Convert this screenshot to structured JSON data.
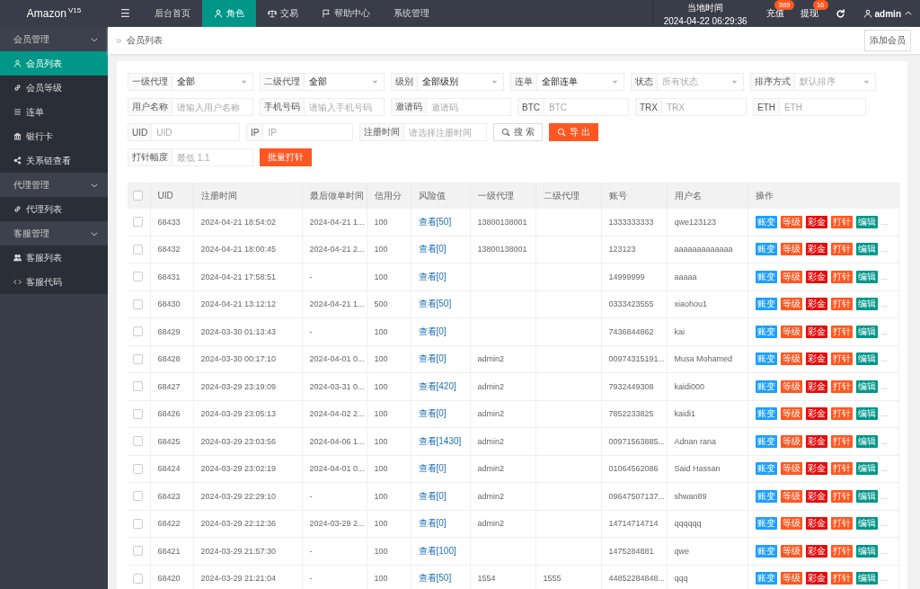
{
  "topbar": {
    "logo": "Amazon",
    "version": "V15",
    "menu_icon": "☰",
    "nav": [
      {
        "label": "后台首页",
        "selected": false
      },
      {
        "label": "角色",
        "selected": true
      },
      {
        "label": "交易",
        "selected": false
      },
      {
        "label": "帮助中心",
        "selected": false
      },
      {
        "label": "系统管理",
        "selected": false
      }
    ],
    "clock": {
      "label": "当地时间",
      "time": "2024-04-22 06:29:36"
    },
    "counters": [
      {
        "label": "充值",
        "badge": "389"
      },
      {
        "label": "提现",
        "badge": "16"
      }
    ],
    "user": "admin"
  },
  "sidebar": {
    "groups": [
      {
        "label": "会员管理",
        "expanded": true,
        "children": [
          {
            "label": "会员列表",
            "selected": true
          },
          {
            "label": "会员等级",
            "selected": false
          },
          {
            "label": "连单",
            "selected": false
          },
          {
            "label": "银行卡",
            "selected": false
          },
          {
            "label": "关系链查看",
            "selected": false
          }
        ]
      },
      {
        "label": "代理管理",
        "expanded": true,
        "children": [
          {
            "label": "代理列表",
            "selected": false
          }
        ]
      },
      {
        "label": "客服管理",
        "expanded": true,
        "children": [
          {
            "label": "客服列表",
            "selected": false
          },
          {
            "label": "客服代码",
            "selected": false
          }
        ]
      }
    ]
  },
  "breadcrumb": "会员列表",
  "add_button": "添加会员",
  "filters": [
    [
      {
        "kind": "select",
        "label": "一级代理",
        "value": "全部"
      },
      {
        "kind": "select",
        "label": "二级代理",
        "value": "全部"
      },
      {
        "kind": "select",
        "label": "级别",
        "value": "全部级别"
      },
      {
        "kind": "select",
        "label": "连单",
        "value": "全部连单"
      },
      {
        "kind": "select",
        "label": "状态",
        "placeholder": "所有状态"
      },
      {
        "kind": "select",
        "label": "排序方式",
        "placeholder": "默认排序"
      }
    ],
    [
      {
        "kind": "input",
        "label": "用户名称",
        "placeholder": "请输入用户名称"
      },
      {
        "kind": "input",
        "label": "手机号码",
        "placeholder": "请输入手机号码"
      },
      {
        "kind": "input",
        "label": "邀请码",
        "placeholder": "邀请码"
      },
      {
        "kind": "input",
        "label": "BTC",
        "placeholder": "BTC"
      },
      {
        "kind": "input",
        "label": "TRX",
        "placeholder": "TRX"
      },
      {
        "kind": "input",
        "label": "ETH",
        "placeholder": "ETH"
      }
    ],
    [
      {
        "kind": "input",
        "label": "UID",
        "placeholder": "UID"
      },
      {
        "kind": "input",
        "label": "IP",
        "placeholder": "IP"
      },
      {
        "kind": "input",
        "label": "注册时间",
        "placeholder": "请选择注册时间"
      },
      {
        "kind": "button",
        "label": "搜 索"
      },
      {
        "kind": "button",
        "label": "导 出"
      }
    ],
    [
      {
        "kind": "input",
        "label": "打针幅度",
        "placeholder": "最低 1.1"
      },
      {
        "kind": "button",
        "label": "批量打针"
      }
    ]
  ],
  "table": {
    "header_checkbox": {
      "checked": false
    },
    "columns": [
      "UID",
      "注册时间",
      "最后做单时间",
      "信用分",
      "风险值",
      "一级代理",
      "二级代理",
      "账号",
      "用户名",
      "操作"
    ],
    "rows": [
      {
        "checked": false,
        "uid": "68433",
        "registered": "2024-04-21 18:54:02",
        "last_order": "2024-04-21 1...",
        "credit": "100",
        "risk": "查看[50]",
        "agent_1": "13800138001",
        "account": "1333333333",
        "username": "qwe123123",
        "actions": [
          {
            "label": "账变",
            "color": "#1e9fff"
          },
          {
            "label": "等级",
            "color": "#ff5722"
          },
          {
            "label": "彩金",
            "color": "#e50e0e"
          },
          {
            "label": "打针",
            "color": "#ff5722"
          },
          {
            "label": "编辑",
            "color": "#009688"
          }
        ],
        "more": "..."
      },
      {
        "checked": false,
        "uid": "68432",
        "registered": "2024-04-21 18:00:45",
        "last_order": "2024-04-21 2...",
        "credit": "100",
        "risk": "查看[0]",
        "agent_1": "13800138001",
        "account": "123123",
        "username": "aaaaaaaaaaaaa",
        "actions": [
          {
            "label": "账变",
            "color": "#1e9fff"
          },
          {
            "label": "等级",
            "color": "#ff5722"
          },
          {
            "label": "彩金",
            "color": "#e50e0e"
          },
          {
            "label": "打针",
            "color": "#ff5722"
          },
          {
            "label": "编辑",
            "color": "#009688"
          }
        ],
        "more": "..."
      },
      {
        "checked": false,
        "uid": "68431",
        "registered": "2024-04-21 17:58:51",
        "last_order": "-",
        "credit": "100",
        "risk": "查看[0]",
        "account": "14999999",
        "username": "aaaaa",
        "actions": [
          {
            "label": "账变",
            "color": "#1e9fff"
          },
          {
            "label": "等级",
            "color": "#ff5722"
          },
          {
            "label": "彩金",
            "color": "#e50e0e"
          },
          {
            "label": "打针",
            "color": "#ff5722"
          },
          {
            "label": "编辑",
            "color": "#009688"
          }
        ],
        "more": "..."
      },
      {
        "checked": false,
        "uid": "68430",
        "registered": "2024-04-21 13:12:12",
        "last_order": "2024-04-21 1...",
        "credit": "500",
        "risk": "查看[50]",
        "account": "0333423555",
        "username": "xiaohou1",
        "actions": [
          {
            "label": "账变",
            "color": "#1e9fff"
          },
          {
            "label": "等级",
            "color": "#ff5722"
          },
          {
            "label": "彩金",
            "color": "#e50e0e"
          },
          {
            "label": "打针",
            "color": "#ff5722"
          },
          {
            "label": "编辑",
            "color": "#009688"
          }
        ],
        "more": "..."
      },
      {
        "checked": false,
        "uid": "68429",
        "registered": "2024-03-30 01:13:43",
        "last_order": "-",
        "credit": "100",
        "risk": "查看[0]",
        "account": "7436844862",
        "username": "kai",
        "actions": [
          {
            "label": "账变",
            "color": "#1e9fff"
          },
          {
            "label": "等级",
            "color": "#ff5722"
          },
          {
            "label": "彩金",
            "color": "#e50e0e"
          },
          {
            "label": "打针",
            "color": "#ff5722"
          },
          {
            "label": "编辑",
            "color": "#009688"
          }
        ],
        "more": "..."
      },
      {
        "checked": false,
        "uid": "68428",
        "registered": "2024-03-30 00:17:10",
        "last_order": "2024-04-01 0...",
        "credit": "100",
        "risk": "查看[0]",
        "agent_1": "admin2",
        "account": "00974315191...",
        "username": "Musa Mohamed",
        "actions": [
          {
            "label": "账变",
            "color": "#1e9fff"
          },
          {
            "label": "等级",
            "color": "#ff5722"
          },
          {
            "label": "彩金",
            "color": "#e50e0e"
          },
          {
            "label": "打针",
            "color": "#ff5722"
          },
          {
            "label": "编辑",
            "color": "#009688"
          }
        ],
        "more": "..."
      },
      {
        "checked": false,
        "uid": "68427",
        "registered": "2024-03-29 23:19:09",
        "last_order": "2024-03-31 0...",
        "credit": "100",
        "risk": "查看[420]",
        "agent_1": "admin2",
        "account": "7932449308",
        "username": "kaidi000",
        "actions": [
          {
            "label": "账变",
            "color": "#1e9fff"
          },
          {
            "label": "等级",
            "color": "#ff5722"
          },
          {
            "label": "彩金",
            "color": "#e50e0e"
          },
          {
            "label": "打针",
            "color": "#ff5722"
          },
          {
            "label": "编辑",
            "color": "#009688"
          }
        ],
        "more": "..."
      },
      {
        "checked": false,
        "uid": "68426",
        "registered": "2024-03-29 23:05:13",
        "last_order": "2024-04-02 2...",
        "credit": "100",
        "risk": "查看[0]",
        "agent_1": "admin2",
        "account": "7852233825",
        "username": "kaidi1",
        "actions": [
          {
            "label": "账变",
            "color": "#1e9fff"
          },
          {
            "label": "等级",
            "color": "#ff5722"
          },
          {
            "label": "彩金",
            "color": "#e50e0e"
          },
          {
            "label": "打针",
            "color": "#ff5722"
          },
          {
            "label": "编辑",
            "color": "#009688"
          }
        ],
        "more": "..."
      },
      {
        "checked": false,
        "uid": "68425",
        "registered": "2024-03-29 23:03:56",
        "last_order": "2024-04-06 1...",
        "credit": "100",
        "risk": "查看[1430]",
        "agent_1": "admin2",
        "account": "00971563885...",
        "username": "Adnan rana",
        "actions": [
          {
            "label": "账变",
            "color": "#1e9fff"
          },
          {
            "label": "等级",
            "color": "#ff5722"
          },
          {
            "label": "彩金",
            "color": "#e50e0e"
          },
          {
            "label": "打针",
            "color": "#ff5722"
          },
          {
            "label": "编辑",
            "color": "#009688"
          }
        ],
        "more": "..."
      },
      {
        "checked": false,
        "uid": "68424",
        "registered": "2024-03-29 23:02:19",
        "last_order": "2024-04-01 0...",
        "credit": "100",
        "risk": "查看[0]",
        "agent_1": "admin2",
        "account": "01064562086",
        "username": "Said Hassan",
        "actions": [
          {
            "label": "账变",
            "color": "#1e9fff"
          },
          {
            "label": "等级",
            "color": "#ff5722"
          },
          {
            "label": "彩金",
            "color": "#e50e0e"
          },
          {
            "label": "打针",
            "color": "#ff5722"
          },
          {
            "label": "编辑",
            "color": "#009688"
          }
        ],
        "more": "..."
      },
      {
        "checked": false,
        "uid": "68423",
        "registered": "2024-03-29 22:29:10",
        "last_order": "-",
        "credit": "100",
        "risk": "查看[0]",
        "agent_1": "admin2",
        "account": "09647507137...",
        "username": "shwan89",
        "actions": [
          {
            "label": "账变",
            "color": "#1e9fff"
          },
          {
            "label": "等级",
            "color": "#ff5722"
          },
          {
            "label": "彩金",
            "color": "#e50e0e"
          },
          {
            "label": "打针",
            "color": "#ff5722"
          },
          {
            "label": "编辑",
            "color": "#009688"
          }
        ],
        "more": "..."
      },
      {
        "checked": false,
        "uid": "68422",
        "registered": "2024-03-29 22:12:36",
        "last_order": "2024-03-29 2...",
        "credit": "100",
        "risk": "查看[0]",
        "agent_1": "admin2",
        "account": "14714714714",
        "username": "qqqqqq",
        "actions": [
          {
            "label": "账变",
            "color": "#1e9fff"
          },
          {
            "label": "等级",
            "color": "#ff5722"
          },
          {
            "label": "彩金",
            "color": "#e50e0e"
          },
          {
            "label": "打针",
            "color": "#ff5722"
          },
          {
            "label": "编辑",
            "color": "#009688"
          }
        ],
        "more": "..."
      },
      {
        "checked": false,
        "uid": "68421",
        "registered": "2024-03-29 21:57:30",
        "last_order": "-",
        "credit": "100",
        "risk": "查看[100]",
        "account": "1475284881",
        "username": "qwe",
        "actions": [
          {
            "label": "账变",
            "color": "#1e9fff"
          },
          {
            "label": "等级",
            "color": "#ff5722"
          },
          {
            "label": "彩金",
            "color": "#e50e0e"
          },
          {
            "label": "打针",
            "color": "#ff5722"
          },
          {
            "label": "编辑",
            "color": "#009688"
          }
        ],
        "more": "..."
      },
      {
        "checked": false,
        "uid": "68420",
        "registered": "2024-03-29 21:21:04",
        "last_order": "-",
        "credit": "100",
        "risk": "查看[50]",
        "agent_1": "1554",
        "agent_2": "1555",
        "account": "44852284848...",
        "username": "qqq",
        "actions": [
          {
            "label": "账变",
            "color": "#1e9fff"
          },
          {
            "label": "等级",
            "color": "#ff5722"
          },
          {
            "label": "彩金",
            "color": "#e50e0e"
          },
          {
            "label": "打针",
            "color": "#ff5722"
          },
          {
            "label": "编辑",
            "color": "#009688"
          }
        ],
        "more": "..."
      }
    ]
  }
}
